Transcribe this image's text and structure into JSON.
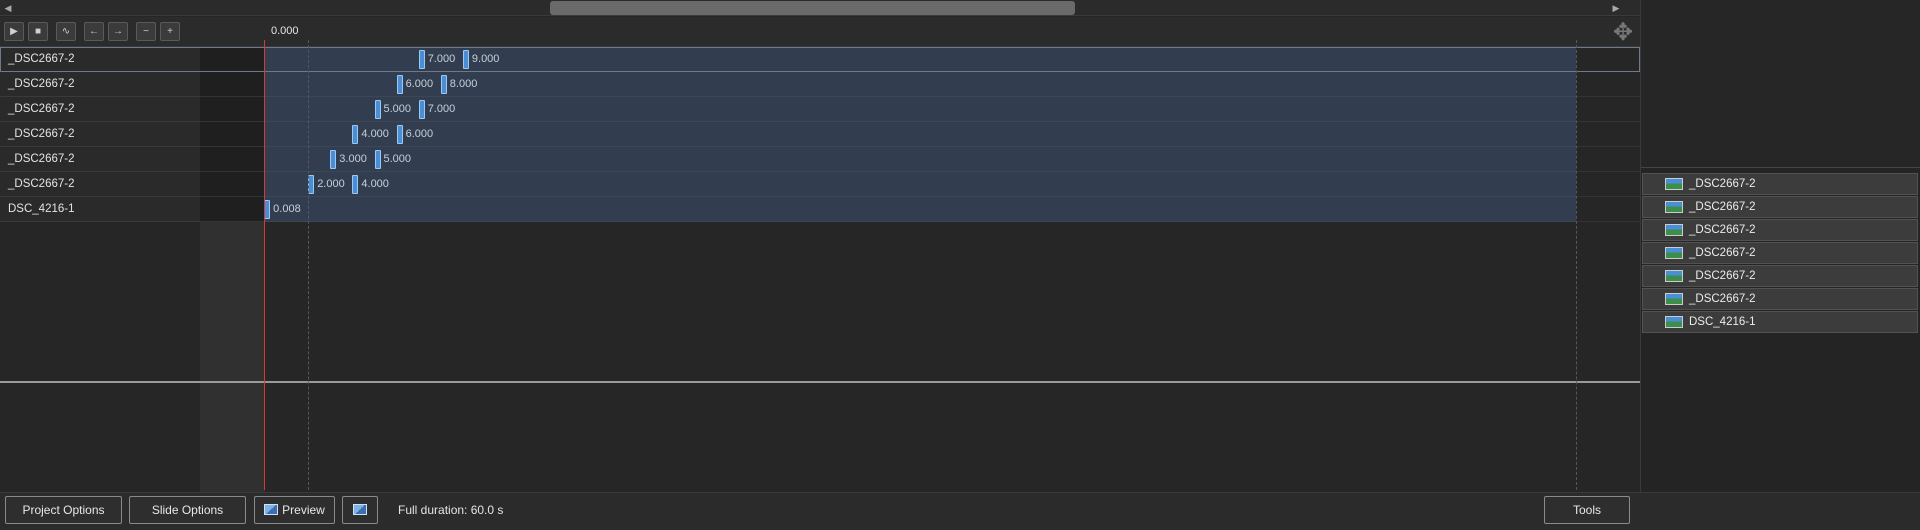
{
  "ruler": {
    "current_time": "0.000"
  },
  "toolbar": {
    "play_icon": "▶",
    "stop_icon": "■",
    "wave_icon": "∿",
    "prev_icon": "←",
    "next_icon": "→",
    "zoom_out_icon": "−",
    "zoom_in_icon": "+"
  },
  "tracks": [
    {
      "name": "_DSC2667-2",
      "keyframes": [
        "7.000",
        "9.000"
      ]
    },
    {
      "name": "_DSC2667-2",
      "keyframes": [
        "6.000",
        "8.000"
      ]
    },
    {
      "name": "_DSC2667-2",
      "keyframes": [
        "5.000",
        "7.000"
      ]
    },
    {
      "name": "_DSC2667-2",
      "keyframes": [
        "4.000",
        "6.000"
      ]
    },
    {
      "name": "_DSC2667-2",
      "keyframes": [
        "3.000",
        "5.000"
      ]
    },
    {
      "name": "_DSC2667-2",
      "keyframes": [
        "2.000",
        "4.000"
      ]
    },
    {
      "name": "DSC_4216-1",
      "keyframes": [
        "0.008"
      ]
    }
  ],
  "slide_list": [
    "_DSC2667-2",
    "_DSC2667-2",
    "_DSC2667-2",
    "_DSC2667-2",
    "_DSC2667-2",
    "_DSC2667-2",
    "DSC_4216-1"
  ],
  "bottom": {
    "project_options": "Project Options",
    "slide_options": "Slide Options",
    "preview": "Preview",
    "status": "Full duration: 60.0 s",
    "tools": "Tools"
  },
  "colors": {
    "track": "#323e4f",
    "keyframe": "#4a8fd6",
    "playhead": "#d43a3a"
  },
  "icons": {
    "move": "move-icon",
    "thumbnail": "image-thumbnail-icon"
  }
}
